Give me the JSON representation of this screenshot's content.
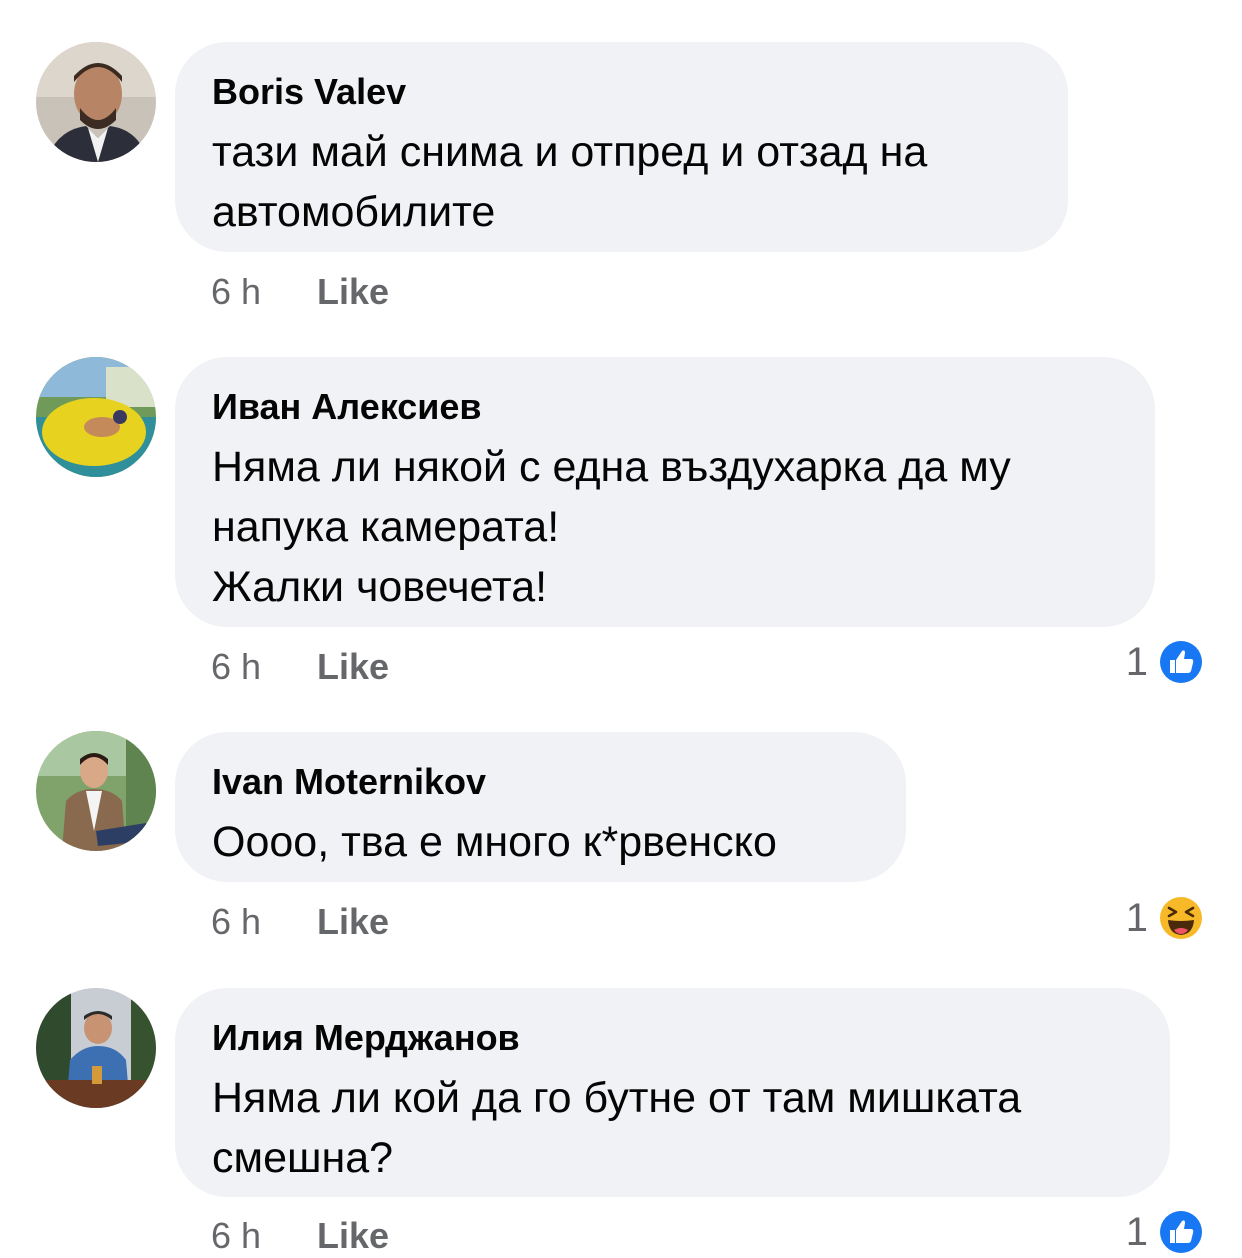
{
  "comments": [
    {
      "author": "Boris Valev",
      "text": "тази май снима и отпред и отзад на\nавтомобилите",
      "time": "6 h",
      "like_label": "Like",
      "reaction_count": "",
      "reaction_icon": ""
    },
    {
      "author": "Иван Алексиев",
      "text": "Няма ли някой с една въздухарка да му\nнапука камерата!\nЖалки човечета!",
      "time": "6 h",
      "like_label": "Like",
      "reaction_count": "1",
      "reaction_icon": "like-icon"
    },
    {
      "author": "Ivan Moternikov",
      "text": "Оооо, тва е много к*рвенско",
      "time": "6 h",
      "like_label": "Like",
      "reaction_count": "1",
      "reaction_icon": "haha-icon"
    },
    {
      "author": "Илия Мерджанов",
      "text": "Няма ли кой да го бутне от там мишката\nсмешна?",
      "time": "6 h",
      "like_label": "Like",
      "reaction_count": "1",
      "reaction_icon": "like-icon"
    }
  ],
  "colors": {
    "bubble": "#f0f2f5",
    "meta_text": "#65676b",
    "like_blue": "#1877f2",
    "haha_yellow": "#f7b928"
  }
}
